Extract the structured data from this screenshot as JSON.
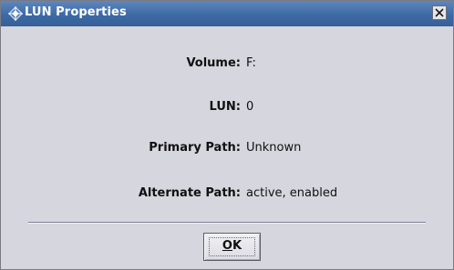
{
  "window": {
    "title": "LUN Properties",
    "icon": "diamond-logo-icon",
    "close_icon": "close-icon"
  },
  "properties": [
    {
      "label": "Volume:",
      "value": "F:"
    },
    {
      "label": "LUN:",
      "value": "0"
    },
    {
      "label": "Primary Path:",
      "value": "Unknown"
    },
    {
      "label": "Alternate Path:",
      "value": "active, enabled"
    }
  ],
  "buttons": {
    "ok_mnemonic": "O",
    "ok_rest": "K"
  },
  "colors": {
    "titlebar": "#3d6aa5",
    "background": "#d6d6de",
    "title_text": "#ffffff"
  }
}
